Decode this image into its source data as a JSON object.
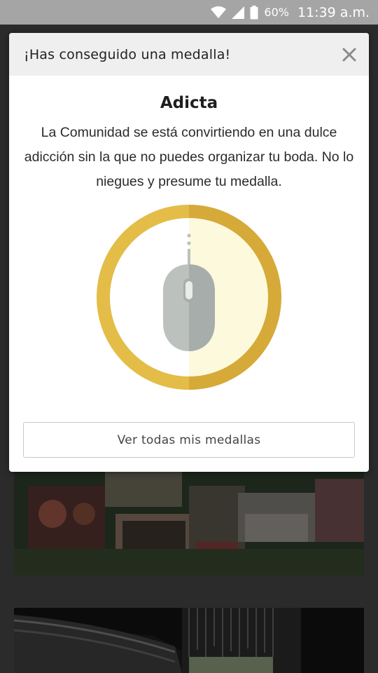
{
  "status_bar": {
    "wifi_icon": "wifi-icon",
    "signal_icon": "signal-icon",
    "battery_icon": "battery-icon",
    "battery_percent": "60%",
    "time": "11:39 a.m."
  },
  "modal": {
    "header_title": "¡Has conseguido una medalla!",
    "close_icon": "close-icon",
    "medal_name": "Adicta",
    "description": "La Comunidad se está convirtiendo en una dulce adicción sin la que no puedes organizar tu boda. No lo niegues y presume tu medalla.",
    "medal_icon": "computer-mouse-icon",
    "cta_label": "Ver todas mis medallas"
  },
  "colors": {
    "medal_gold_light": "#e3bd47",
    "medal_gold_dark": "#d6aa38",
    "medal_inner_right": "#fdf9dc",
    "mouse_light": "#bcc1bd",
    "mouse_dark": "#a7adab"
  }
}
